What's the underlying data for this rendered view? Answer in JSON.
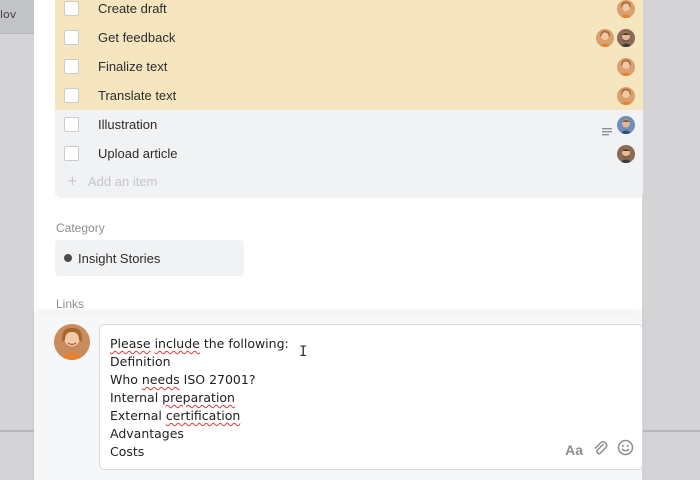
{
  "background": {
    "tab_fragment": "lov"
  },
  "checklist": {
    "items": [
      {
        "label": "Create draft",
        "highlighted": true,
        "avatars": [
          "avatar-woman-orange"
        ]
      },
      {
        "label": "Get feedback",
        "highlighted": true,
        "avatars": [
          "avatar-woman-orange",
          "avatar-man-brown"
        ]
      },
      {
        "label": "Finalize text",
        "highlighted": true,
        "avatars": [
          "avatar-woman-orange"
        ]
      },
      {
        "label": "Translate text",
        "highlighted": true,
        "avatars": [
          "avatar-woman-orange"
        ]
      },
      {
        "label": "Illustration",
        "highlighted": false,
        "has_description": true,
        "avatars": [
          "avatar-man-blue"
        ]
      },
      {
        "label": "Upload article",
        "highlighted": false,
        "avatars": [
          "avatar-man-brown"
        ]
      }
    ],
    "add_item_label": "Add an item"
  },
  "category": {
    "label": "Category",
    "value": "Insight Stories",
    "dot_color": "#4a4a4a"
  },
  "links": {
    "label": "Links"
  },
  "comment": {
    "lines": [
      "Please include the following:",
      "Definition",
      "Who needs ISO 27001?",
      "Internal preparation",
      "External certification",
      "Advantages",
      "Costs"
    ],
    "tools": {
      "format_label": "Aa"
    }
  },
  "colors": {
    "highlight": "#f5e6bf",
    "checklist_bg": "#f1f2f4",
    "spellcheck": "#e03a3a"
  }
}
